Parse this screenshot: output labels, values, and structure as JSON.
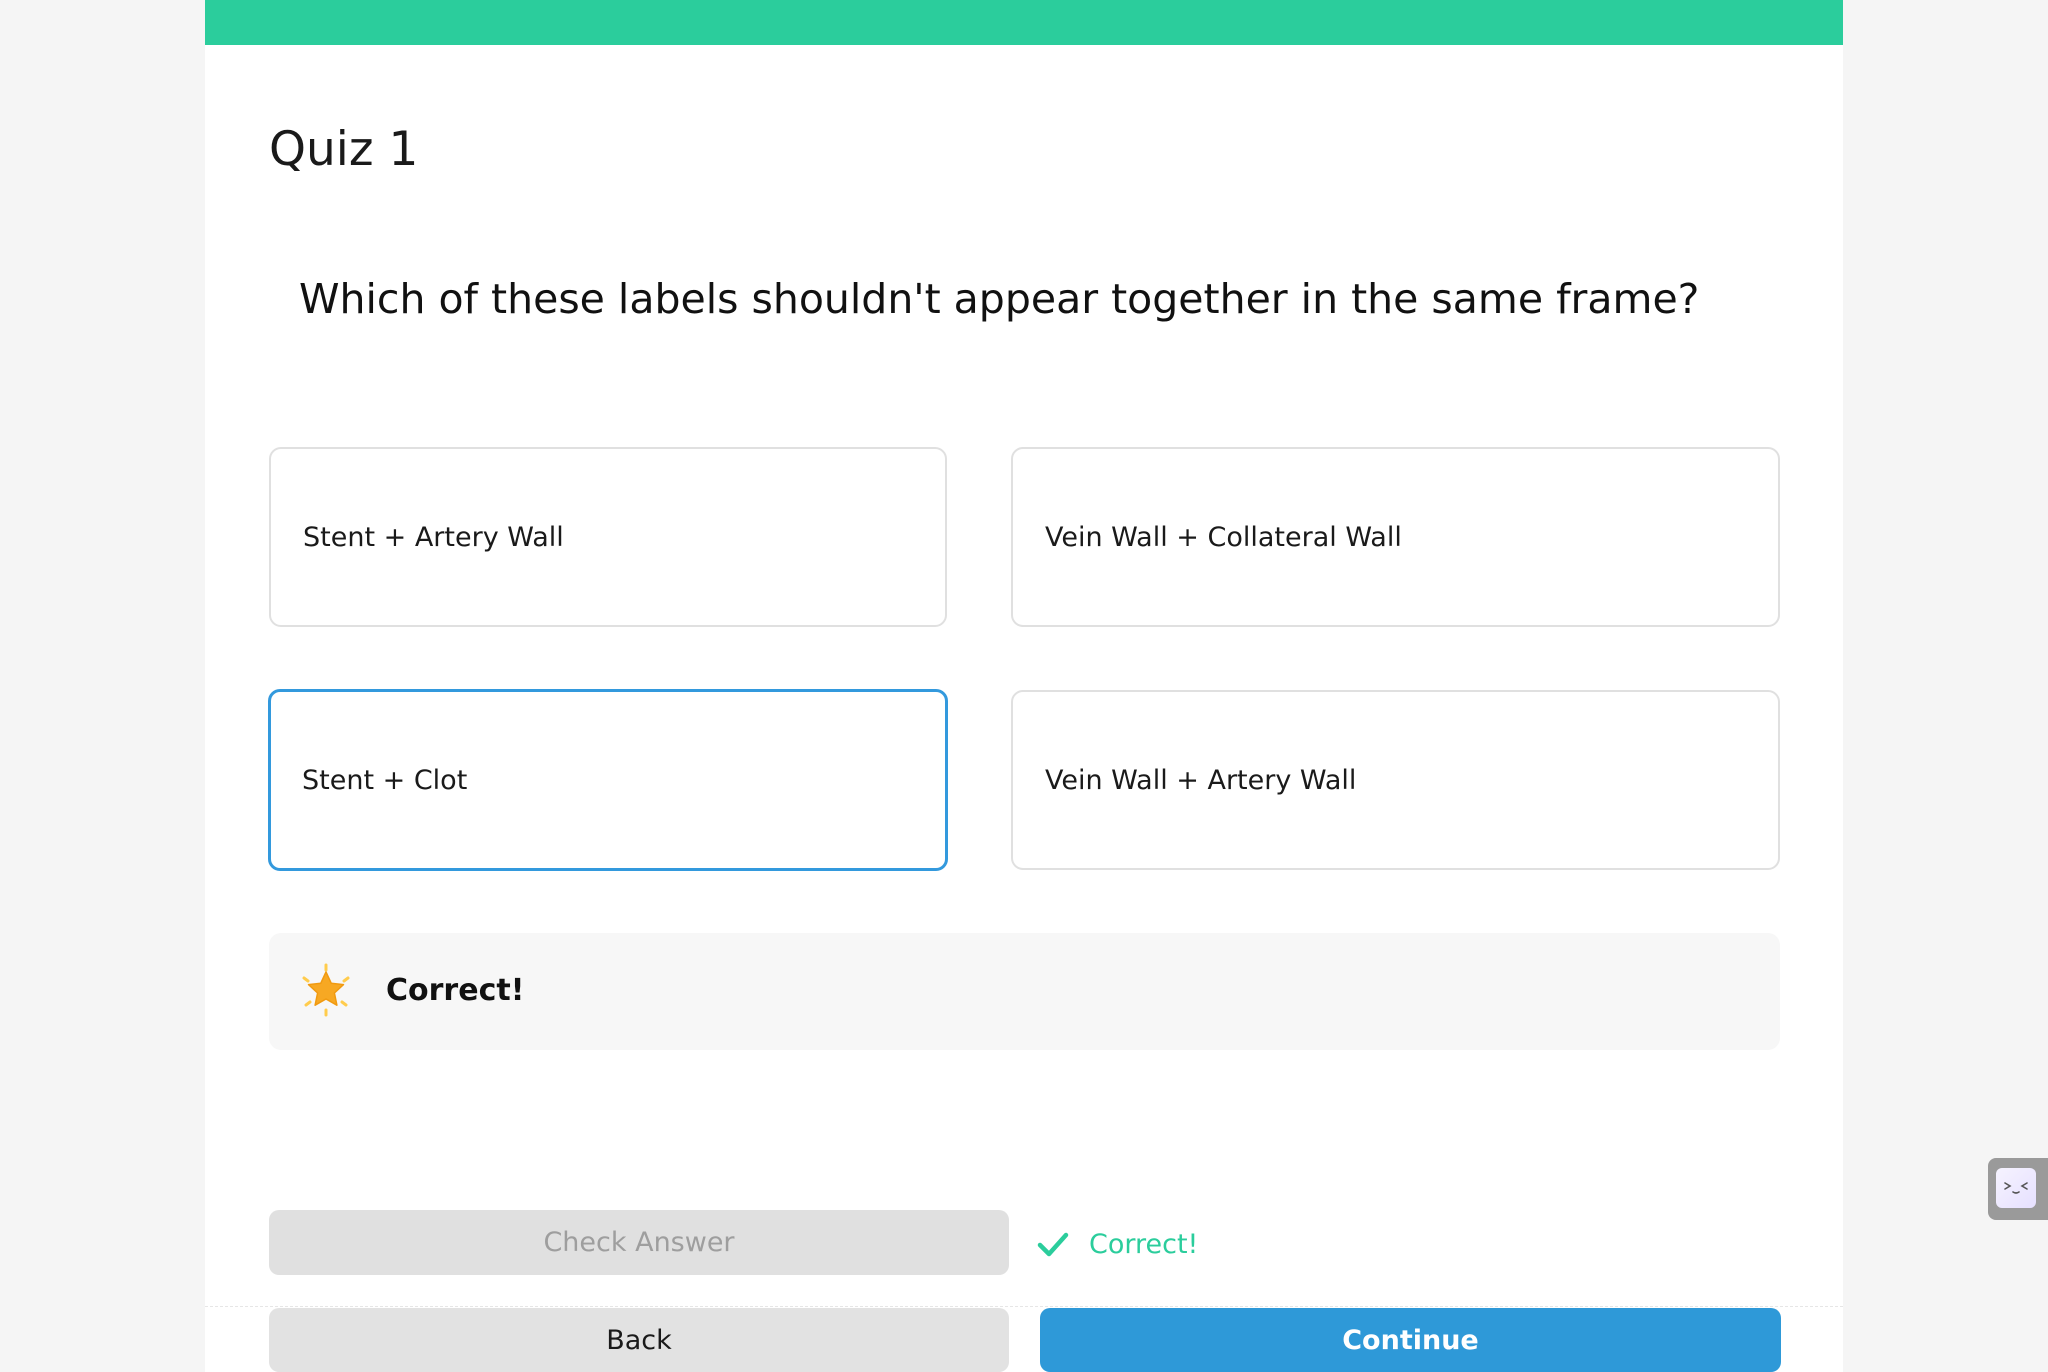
{
  "quiz": {
    "title": "Quiz 1",
    "question": "Which of these labels shouldn't appear together in the same frame?"
  },
  "options": [
    {
      "label": "Stent + Artery Wall",
      "selected": false
    },
    {
      "label": "Vein Wall + Collateral Wall",
      "selected": false
    },
    {
      "label": "Stent + Clot",
      "selected": true
    },
    {
      "label": "Vein Wall + Artery Wall",
      "selected": false
    }
  ],
  "feedback": {
    "icon": "star-icon",
    "text": "Correct!"
  },
  "actions": {
    "check_label": "Check Answer",
    "status_icon": "checkmark-icon",
    "status_text": "Correct!",
    "back_label": "Back",
    "continue_label": "Continue"
  },
  "colors": {
    "accent_green": "#2bcd9c",
    "selected_border": "#3399dd",
    "primary_button": "#2e99d8"
  }
}
